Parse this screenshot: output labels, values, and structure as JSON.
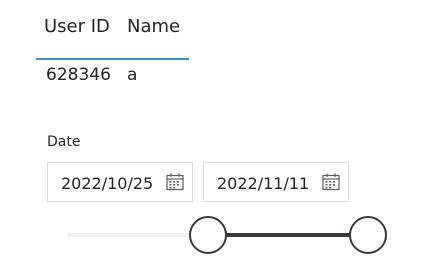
{
  "table": {
    "columns": [
      "User ID",
      "Name"
    ],
    "rows": [
      {
        "user_id": "628346",
        "name": "a"
      }
    ],
    "header_border_color": "#3b8ed8"
  },
  "date_slicer": {
    "title": "Date",
    "start_date": "2022/10/25",
    "end_date": "2022/11/11",
    "start_icon": "calendar-icon",
    "end_icon": "calendar-icon",
    "range_start_fraction": 0.44,
    "range_end_fraction": 0.94,
    "colors": {
      "track": "#f0f0f0",
      "track_fill": "#3b3a39",
      "handle_border": "#3b3a39"
    }
  }
}
